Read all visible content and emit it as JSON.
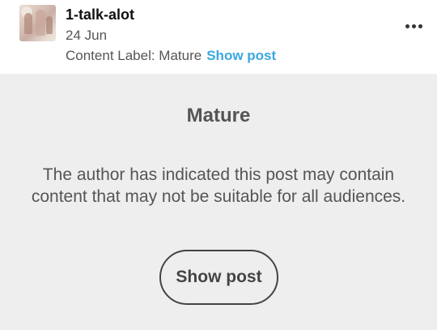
{
  "post": {
    "username": "1-talk-alot",
    "date": "24 Jun",
    "content_label_text": "Content Label: Mature",
    "show_post_link": "Show post",
    "more_icon": "more-horizontal-icon"
  },
  "warning": {
    "title": "Mature",
    "description": "The author has indicated this post may contain content that may not be suitable for all audiences.",
    "button_label": "Show post"
  },
  "colors": {
    "link_blue": "#3aa7e0",
    "panel_bg": "#eeeeee",
    "text_gray": "#555555"
  }
}
